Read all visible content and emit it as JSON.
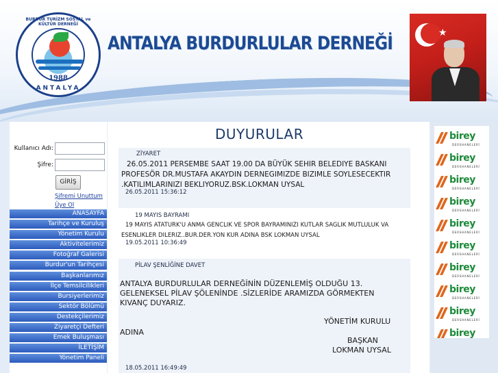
{
  "header": {
    "title": "ANTALYA BURDURLULAR DERNEĞİ",
    "logo": {
      "ring_text": "BURDUR TURİZM SOSYAL ve KÜLTÜR DERNEĞİ",
      "year": "1988",
      "city": "ANTALYA"
    }
  },
  "login": {
    "username_label": "Kullanıcı Adı:",
    "username_value": "",
    "password_label": "Şifre:",
    "password_value": "",
    "submit_label": "GİRİŞ",
    "forgot_password": "Şifremi Unuttum",
    "register": "Üye Ol"
  },
  "menu": {
    "items": [
      "ANASAYFA",
      "Tarihçe ve Kuruluş",
      "Yönetim Kurulu",
      "Aktivitelerimiz",
      "Fotoğraf Galerisi",
      "Burdur'un Tarihçesi",
      "Başkanlarımız",
      "İlçe Temsilcilikleri",
      "Bursiyerlerimiz",
      "Sektör Bölümü",
      "Destekçilerimiz",
      "Ziyaretçi Defteri",
      "Emek Buluşması",
      "İLETİŞİM",
      "Yönetim Paneli"
    ]
  },
  "main": {
    "page_title": "DUYURULAR",
    "announcements": [
      {
        "title": "ZİYARET",
        "lines": [
          "26.05.2011 PERSEMBE SAAT 19.00 DA BÜYÜK SEHIR BELEDIYE BASKANI",
          "PROFESÖR DR.MUSTAFA AKAYDIN DERNEGIMIZDE BIZIMLE SOYLESECEKTIR",
          ".KATILIMLARINIZI BEKLIYORUZ.BSK.LOKMAN UYSAL"
        ],
        "date": "26.05.2011 15:36:12"
      },
      {
        "title": "19 MAYIS BAYRAMI",
        "lines": [
          "19 MAYIS ATATURK'U ANMA GENCLIK VE SPOR BAYRAMINIZI KUTLAR SAGLIK MUTLULUK VA",
          "ESENLIKLER DILERIZ..BUR.DER.YON KUR ADINA BSK LOKMAN UYSAL"
        ],
        "date": "19.05.2011 10:36:49"
      },
      {
        "title": "PİLAV ŞENLİĞİNE DAVET",
        "lines": [
          "ANTALYA BURDURLULAR DERNEĞİNİN  DÜZENLEMİŞ OLDUĞU 13.",
          "GELENEKSEL PİLAV ŞÖLENİNDE .SİZLERİDE ARAMIZDA GÖRMEKTEN",
          "KIVANÇ DUYARIZ."
        ],
        "sign_1": "YÖNETİM KURULU",
        "sign_2": "ADINA",
        "sign_3": "BAŞKAN",
        "sign_4": "LOKMAN  UYSAL",
        "date": "18.05.2011 16:49:49"
      }
    ]
  },
  "sponsors": {
    "brand": "birey",
    "subtitle": "DERSHANELERİ",
    "count": 10
  },
  "colors": {
    "menu_bg": "#2c5bbd",
    "title": "#1c4a93",
    "sponsor_green": "#1d8a3a",
    "sponsor_orange": "#e0661d"
  }
}
